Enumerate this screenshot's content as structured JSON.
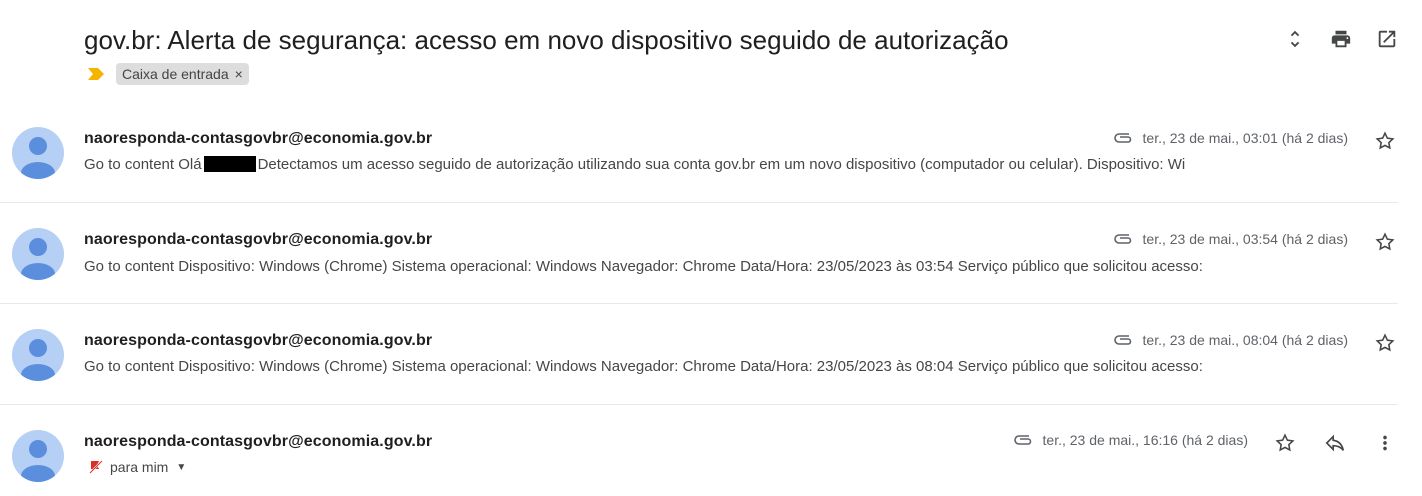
{
  "thread": {
    "subject": "gov.br: Alerta de segurança: acesso em novo dispositivo seguido de autorização",
    "label": "Caixa de entrada",
    "label_remove": "×"
  },
  "messages": [
    {
      "sender": "naoresponda-contasgovbr@economia.gov.br",
      "date": "ter., 23 de mai., 03:01 (há 2 dias)",
      "snippet_before": "Go to content Olá",
      "snippet_after": "Detectamos um acesso seguido de autorização utilizando sua conta gov.br em um novo dispositivo (computador ou celular). Dispositivo: Wi"
    },
    {
      "sender": "naoresponda-contasgovbr@economia.gov.br",
      "date": "ter., 23 de mai., 03:54 (há 2 dias)",
      "snippet": "Go to content Dispositivo: Windows (Chrome) Sistema operacional: Windows Navegador: Chrome Data/Hora: 23/05/2023 às 03:54 Serviço público que solicitou acesso:"
    },
    {
      "sender": "naoresponda-contasgovbr@economia.gov.br",
      "date": "ter., 23 de mai., 08:04 (há 2 dias)",
      "snippet": "Go to content Dispositivo: Windows (Chrome) Sistema operacional: Windows Navegador: Chrome Data/Hora: 23/05/2023 às 08:04 Serviço público que solicitou acesso:"
    },
    {
      "sender": "naoresponda-contasgovbr@economia.gov.br",
      "date": "ter., 23 de mai., 16:16 (há 2 dias)",
      "recipient": "para mim"
    }
  ],
  "icons": {
    "expand": "unfold-icon",
    "print": "print-icon",
    "open_new": "open-in-new-icon",
    "important": "important-marker-icon",
    "attachment": "attachment-icon",
    "star": "star-icon",
    "reply": "reply-icon",
    "more": "more-vert-icon"
  },
  "colors": {
    "important": "#f4b400",
    "avatar_bg": "#b6cff4",
    "avatar_fg": "#5b8fde"
  }
}
